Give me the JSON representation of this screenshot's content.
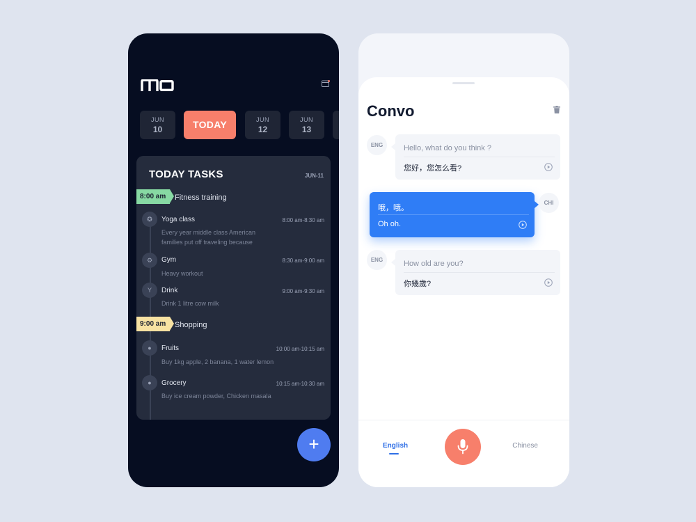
{
  "colors": {
    "page_background": "#dfe4ef",
    "dark_phone": "#060d21",
    "card": "#252c3d",
    "accent_coral": "#f77f6b",
    "accent_blue": "#2f7df6",
    "fab_blue": "#4f7cf0",
    "tag_green": "#87d9a3",
    "tag_yellow": "#f7e2a2"
  },
  "left_app": {
    "logo_icon": "mo-logo",
    "calendar_icon": "calendar-icon",
    "dates": [
      {
        "month": "JUN",
        "day": "10"
      },
      {
        "label": "TODAY"
      },
      {
        "month": "JUN",
        "day": "12"
      },
      {
        "month": "JUN",
        "day": "13"
      }
    ],
    "tasks": {
      "title": "TODAY TASKS",
      "date": "JUN-11",
      "groups": [
        {
          "time": "8:00 am",
          "title": "Fitness training",
          "items": [
            {
              "icon": "yoga-icon",
              "name": "Yoga class",
              "time": "8:00 am-8:30 am",
              "desc": "Every year middle class American families put off traveling because"
            },
            {
              "icon": "gym-icon",
              "name": "Gym",
              "time": "8:30 am-9:00 am",
              "desc": "Heavy workout"
            },
            {
              "icon": "drink-icon",
              "name": "Drink",
              "time": "9:00 am-9:30 am",
              "desc": "Drink 1 litre cow milk"
            }
          ]
        },
        {
          "time": "9:00 am",
          "title": "Shopping",
          "items": [
            {
              "icon": "fruit-icon",
              "name": "Fruits",
              "time": "10:00 am-10:15 am",
              "desc": "Buy 1kg apple, 2 banana, 1 water lemon"
            },
            {
              "icon": "grocery-icon",
              "name": "Grocery",
              "time": "10:15 am-10:30 am",
              "desc": "Buy ice cream powder, Chicken masala"
            }
          ]
        }
      ]
    },
    "fab_label": "+"
  },
  "right_app": {
    "title": "Convo",
    "trash_icon": "trash-icon",
    "messages": [
      {
        "lang": "ENG",
        "source": "Hello, what do you think ?",
        "translation": "您好，您怎么看?"
      },
      {
        "lang": "CHI",
        "source": "哦，哦。",
        "translation": "Oh oh."
      },
      {
        "lang": "ENG",
        "source": "How old are you?",
        "translation": "你幾歲?"
      }
    ],
    "bottom": {
      "left_lang": "English",
      "right_lang": "Chinese",
      "mic_icon": "microphone-icon"
    }
  }
}
